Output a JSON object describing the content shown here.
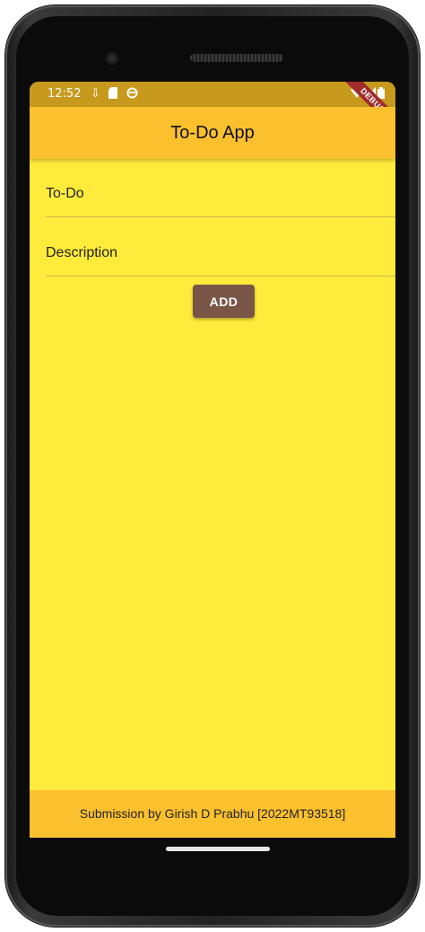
{
  "status_bar": {
    "time": "12:52",
    "icons": [
      "download-icon",
      "sd-card-icon",
      "circle-icon",
      "wifi-icon",
      "signal-icon",
      "battery-icon"
    ]
  },
  "debug_banner": "DEBUG",
  "app_bar": {
    "title": "To-Do App"
  },
  "form": {
    "todo_placeholder": "To-Do",
    "description_placeholder": "Description",
    "todo_value": "",
    "description_value": "",
    "add_label": "ADD"
  },
  "footer": {
    "text": "Submission by Girish D Prabhu [2022MT93518]"
  },
  "colors": {
    "background": "#FFEB3B",
    "app_bar": "#FBC02D",
    "status_bar": "#C79A1E",
    "button": "#795548",
    "debug_banner": "#A12C2C"
  }
}
